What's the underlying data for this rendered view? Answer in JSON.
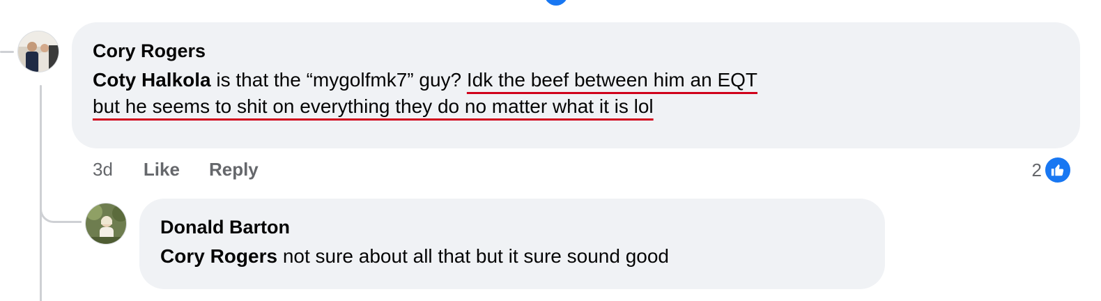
{
  "colors": {
    "link_blue": "#1877f2",
    "bubble_bg": "#f0f2f5",
    "underline_red": "#d0021b",
    "meta_gray": "#65676b"
  },
  "comment": {
    "author": "Cory Rogers",
    "avatar_icon": "avatar-photo",
    "mention": "Coty Halkola",
    "text_plain": " is that the “mygolfmk7” guy? ",
    "text_underlined_1": "Idk the beef between him an EQT",
    "text_underlined_2": "but he seems to shit on everything they do no matter what it is lol",
    "timestamp": "3d",
    "like_label": "Like",
    "reply_label": "Reply",
    "reaction_count": "2",
    "reaction_icon": "thumbs-up-icon"
  },
  "reply": {
    "author": "Donald Barton",
    "avatar_icon": "avatar-photo",
    "mention": "Cory Rogers",
    "text": " not sure about all that but it sure sound good"
  }
}
